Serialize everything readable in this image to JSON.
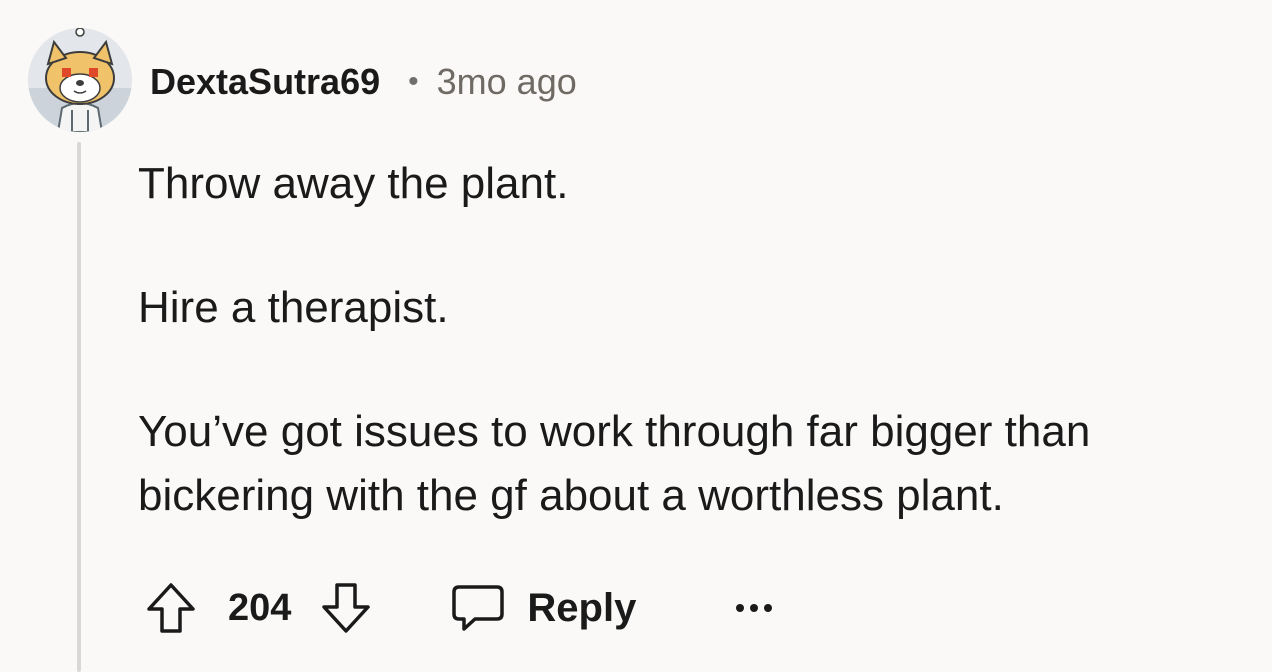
{
  "comment": {
    "username": "DextaSutra69",
    "separator": "•",
    "timestamp": "3mo ago",
    "avatar_icon": "reddit-snoo-dog-avatar",
    "paragraphs": [
      "Throw away the plant.",
      "Hire a therapist.",
      "You’ve got issues to work through far bigger than bickering with the gf about a worthless plant."
    ],
    "actions": {
      "upvote_icon": "arrow-up-icon",
      "score": "204",
      "downvote_icon": "arrow-down-icon",
      "reply_icon": "speech-bubble-icon",
      "reply_label": "Reply",
      "more_icon": "ellipsis-icon"
    }
  },
  "colors": {
    "background": "#faf9f7",
    "text": "#1a1a1b",
    "muted": "#6f6a64",
    "thread_line": "#d9d8d6",
    "avatar_face": "#f0c36a",
    "avatar_eyes": "#e0482a"
  }
}
